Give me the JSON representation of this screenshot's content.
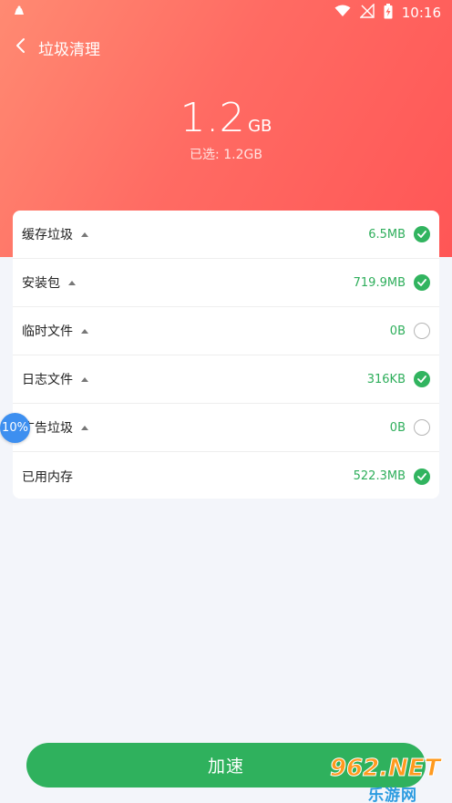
{
  "status_bar": {
    "time": "10:16"
  },
  "nav": {
    "title": "垃圾清理"
  },
  "hero": {
    "amount": "1.2",
    "unit": "GB",
    "selected_text": "已选: 1.2GB"
  },
  "items": [
    {
      "label": "缓存垃圾",
      "value": "6.5MB",
      "checked": true,
      "expandable": true
    },
    {
      "label": "安装包",
      "value": "719.9MB",
      "checked": true,
      "expandable": true
    },
    {
      "label": "临时文件",
      "value": "0B",
      "checked": false,
      "expandable": true
    },
    {
      "label": "日志文件",
      "value": "316KB",
      "checked": true,
      "expandable": true
    },
    {
      "label": "广告垃圾",
      "value": "0B",
      "checked": false,
      "expandable": true
    },
    {
      "label": "已用内存",
      "value": "522.3MB",
      "checked": true,
      "expandable": false
    }
  ],
  "float_badge": {
    "text": "10%"
  },
  "action_button": {
    "label": "加速"
  },
  "watermark": {
    "top": "962.NET",
    "bottom": "乐游网"
  },
  "colors": {
    "header_start": "#ff8a72",
    "header_end": "#ff5656",
    "accent_green": "#2fb15d",
    "badge_blue": "#3d8ff0"
  }
}
